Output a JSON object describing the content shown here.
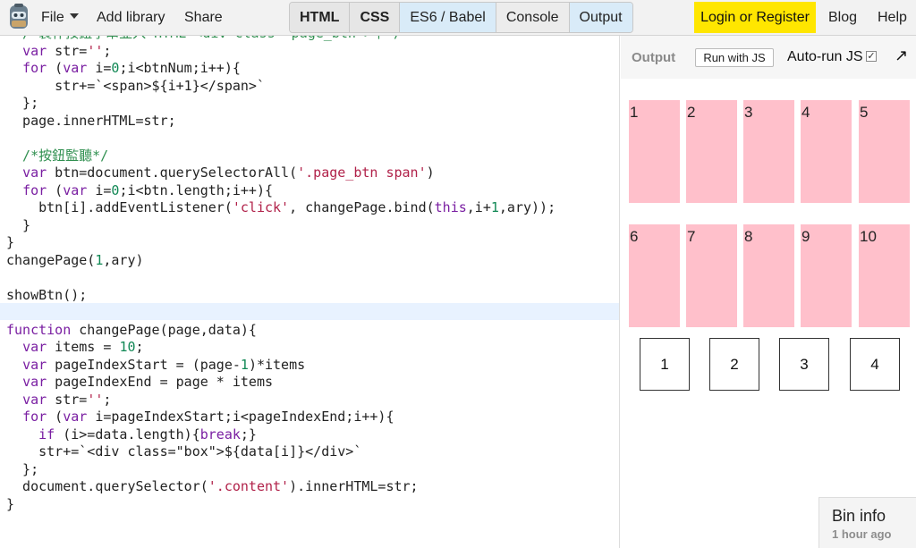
{
  "menu": {
    "file": "File",
    "add_library": "Add library",
    "share": "Share"
  },
  "panels": [
    "HTML",
    "CSS",
    "ES6 / Babel",
    "Console",
    "Output"
  ],
  "right": {
    "login": "Login or Register",
    "blog": "Blog",
    "help": "Help"
  },
  "output": {
    "label": "Output",
    "run_button": "Run with JS",
    "auto_run": "Auto-run JS",
    "auto_run_checked": true,
    "boxes": [
      "1",
      "2",
      "3",
      "4",
      "5",
      "6",
      "7",
      "8",
      "9",
      "10"
    ],
    "page_buttons": [
      "1",
      "2",
      "3",
      "4"
    ]
  },
  "bin_info": {
    "title": "Bin info",
    "subtitle": "1 hour ago"
  },
  "colors": {
    "box": "#ffc0cb",
    "login": "#ffe600",
    "topbar": "#f2f2f2"
  },
  "code_lines": [
    "  /*製作按鈕字串並入 HTML <div class=\"page_btn\">中*/",
    "  var str='';",
    "  for (var i=0;i<btnNum;i++){",
    "      str+=`<span>${i+1}</span>`",
    "  };",
    "  page.innerHTML=str;",
    "",
    "  /*按鈕監聽*/",
    "  var btn=document.querySelectorAll('.page_btn span')",
    "  for (var i=0;i<btn.length;i++){",
    "    btn[i].addEventListener('click', changePage.bind(this,i+1,ary));",
    "  }",
    "}",
    "changePage(1,ary)",
    "",
    "showBtn();",
    "",
    "function changePage(page,data){",
    "  var items = 10;",
    "  var pageIndexStart = (page-1)*items",
    "  var pageIndexEnd = page * items",
    "  var str='';",
    "  for (var i=pageIndexStart;i<pageIndexEnd;i++){",
    "    if (i>=data.length){break;}",
    "    str+=`<div class=\"box\">${data[i]}</div>`",
    "  };",
    "  document.querySelector('.content').innerHTML=str;",
    "}"
  ]
}
